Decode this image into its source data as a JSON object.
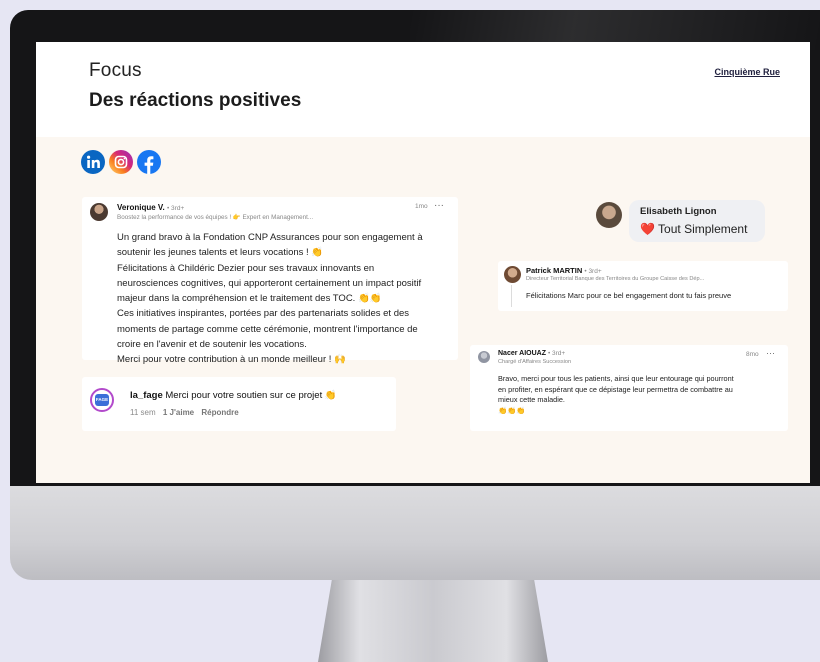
{
  "header": {
    "kicker": "Focus",
    "title": "Des réactions positives",
    "brand": "Cinquième Rue"
  },
  "social_icons": [
    "linkedin-icon",
    "instagram-icon",
    "facebook-icon"
  ],
  "colors": {
    "linkedin": "#0a66c2",
    "facebook": "#1877f2",
    "instagram": "#d62976",
    "screen_bg": "#fcf7f1"
  },
  "post_veronique": {
    "author": "Veronique V.",
    "degree": "• 3rd+",
    "headline": "Boostez la performance de vos équipes ! 👉 Expert en Management...",
    "time": "1mo",
    "more": "···",
    "lines": [
      "Un grand bravo à la Fondation CNP Assurances pour son engagement à",
      "soutenir les jeunes talents et leurs vocations ! 👏",
      "Félicitations à Childéric Dezier pour ses travaux innovants en",
      "neurosciences cognitives, qui apporteront certainement un impact positif",
      "majeur dans la compréhension et le traitement des TOC. 👏👏",
      "Ces initiatives inspirantes, portées par des partenariats solides et des",
      "moments de partage comme cette cérémonie, montrent l'importance de",
      "croire en l'avenir et de soutenir les vocations.",
      "Merci pour votre contribution à un monde meilleur ! 🙌"
    ]
  },
  "comment_lafage": {
    "avatar_text": "FAGE",
    "author": "la_fage",
    "text": "Merci pour votre soutien sur ce projet 👏",
    "time": "11 sem",
    "likes": "1 J'aime",
    "reply": "Répondre"
  },
  "message_elisabeth": {
    "author": "Elisabeth Lignon",
    "text": "❤️ Tout Simplement"
  },
  "comment_patrick": {
    "author": "Patrick MARTIN",
    "degree": "• 3rd+",
    "headline": "Directeur Territorial Banque des Territoires du Groupe Caisse des Dép...",
    "text": "Félicitations Marc pour ce bel engagement dont tu fais preuve"
  },
  "comment_nacer": {
    "author": "Nacer AIOUAZ",
    "degree": "• 3rd+",
    "headline": "Chargé d'Affaires Succession",
    "time": "8mo",
    "more": "···",
    "lines": [
      "Bravo, merci pour tous les patients, ainsi que leur entourage qui pourront",
      "en profiter, en espérant que ce dépistage leur permettra de combattre au",
      "mieux cette maladie.",
      "👏👏👏"
    ]
  }
}
